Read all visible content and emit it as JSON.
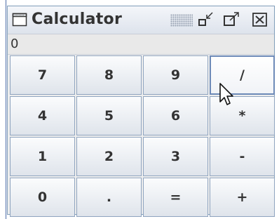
{
  "window": {
    "title": "Calculator",
    "icons": [
      "app-window-icon",
      "minimize-icon",
      "maximize-icon",
      "close-icon"
    ]
  },
  "display": {
    "value": "0"
  },
  "keypad": {
    "rows": [
      [
        "7",
        "8",
        "9",
        "/"
      ],
      [
        "4",
        "5",
        "6",
        "*"
      ],
      [
        "1",
        "2",
        "3",
        "-"
      ],
      [
        "0",
        ".",
        "=",
        "+"
      ]
    ]
  },
  "colors": {
    "accent": "#4c6ca8",
    "button_border": "#8fa4bf",
    "text": "#333333"
  }
}
